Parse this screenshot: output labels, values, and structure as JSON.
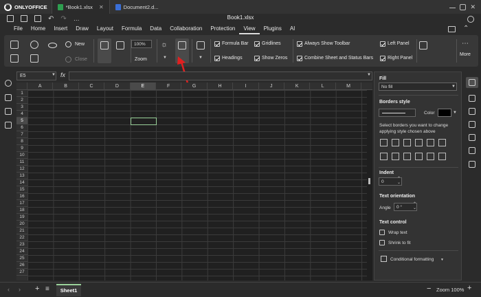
{
  "app": {
    "brand": "ONLYOFFICE",
    "doc_title": "Book1.xlsx"
  },
  "tabs": [
    {
      "label": "*Book1.xlsx",
      "color": "#2e9e4f"
    },
    {
      "label": "Document2.d...",
      "color": "#3a6fd8"
    }
  ],
  "menu": [
    "File",
    "Home",
    "Insert",
    "Draw",
    "Layout",
    "Formula",
    "Data",
    "Collaboration",
    "Protection",
    "View",
    "Plugins",
    "AI"
  ],
  "menu_active": "View",
  "ribbon": {
    "new_label": "New",
    "close_label": "Close",
    "zoom_value": "100%",
    "zoom_label": "Zoom",
    "checks": [
      {
        "label": "Formula Bar",
        "checked": true
      },
      {
        "label": "Headings",
        "checked": true
      },
      {
        "label": "Gridlines",
        "checked": true
      },
      {
        "label": "Show Zeros",
        "checked": true
      },
      {
        "label": "Always Show Toolbar",
        "checked": true
      },
      {
        "label": "Combine Sheet and Status Bars",
        "checked": true
      },
      {
        "label": "Left Panel",
        "checked": true
      },
      {
        "label": "Right Panel",
        "checked": true
      }
    ],
    "more_label": "More"
  },
  "formula": {
    "cell_ref": "E5",
    "fx": "fx",
    "value": ""
  },
  "sheet": {
    "columns": [
      "A",
      "B",
      "C",
      "D",
      "E",
      "F",
      "G",
      "H",
      "I",
      "J",
      "K",
      "L",
      "M"
    ],
    "rows": [
      "1",
      "2",
      "3",
      "4",
      "5",
      "6",
      "7",
      "8",
      "9",
      "10",
      "11",
      "12",
      "13",
      "14",
      "15",
      "16",
      "17",
      "18",
      "19",
      "20",
      "21",
      "22",
      "23",
      "24",
      "25",
      "26",
      "27"
    ],
    "selected_col": "E",
    "selected_row": "5"
  },
  "panel": {
    "fill_title": "Fill",
    "fill_value": "No fill",
    "borders_title": "Borders style",
    "color_label": "Color",
    "borders_hint": "Select borders you want to change applying style chosen above",
    "indent_title": "Indent",
    "indent_value": "0",
    "orientation_title": "Text orientation",
    "angle_label": "Angle",
    "angle_value": "0 °",
    "control_title": "Text control",
    "wrap_label": "Wrap text",
    "shrink_label": "Shrink to fit",
    "cond_format_label": "Conditional formatting"
  },
  "status": {
    "sheet_tab": "Sheet1",
    "zoom": "Zoom 100%"
  }
}
